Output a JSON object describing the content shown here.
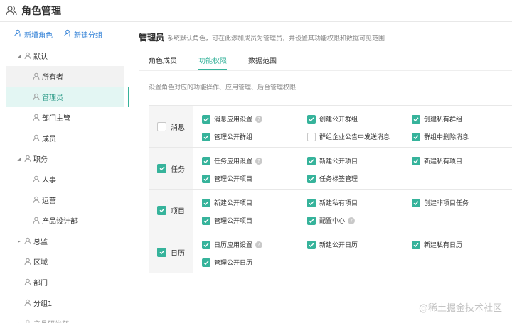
{
  "header": {
    "title": "角色管理",
    "icon": "users-icon"
  },
  "sidebar": {
    "actions": [
      {
        "label": "新增角色"
      },
      {
        "label": "新建分组"
      }
    ],
    "tree": [
      {
        "label": "默认",
        "level": 0,
        "caret": "expanded"
      },
      {
        "label": "所有者",
        "level": 1
      },
      {
        "label": "管理员",
        "level": 1,
        "selected": true
      },
      {
        "label": "部门主管",
        "level": 1
      },
      {
        "label": "成员",
        "level": 1
      },
      {
        "label": "职务",
        "level": 0,
        "caret": "expanded"
      },
      {
        "label": "人事",
        "level": 1
      },
      {
        "label": "运营",
        "level": 1
      },
      {
        "label": "产品设计部",
        "level": 1
      },
      {
        "label": "总监",
        "level": 0,
        "caret": "collapsed"
      },
      {
        "label": "区域",
        "level": 0
      },
      {
        "label": "部门",
        "level": 0
      },
      {
        "label": "分组1",
        "level": 0
      },
      {
        "label": "产品研发部",
        "level": 0,
        "caret": "collapsed"
      }
    ]
  },
  "main": {
    "role_name": "管理员",
    "role_desc": "系统默认角色，可在此添加成员为管理员，并设置其功能权限和数据可见范围",
    "tabs": [
      {
        "label": "角色成员"
      },
      {
        "label": "功能权限",
        "active": true
      },
      {
        "label": "数据范围"
      }
    ],
    "hint": "设置角色对应的功能操作、应用管理、后台管理权限",
    "permissions": [
      {
        "category": "消息",
        "checked": false,
        "items": [
          {
            "label": "消息应用设置",
            "checked": true,
            "help": true
          },
          {
            "label": "创建公开群组",
            "checked": true
          },
          {
            "label": "创建私有群组",
            "checked": true
          },
          {
            "label": "管理公开群组",
            "checked": true
          },
          {
            "label": "群组企业公告中发送消息",
            "checked": false
          },
          {
            "label": "群组中删除消息",
            "checked": true
          }
        ]
      },
      {
        "category": "任务",
        "checked": true,
        "items": [
          {
            "label": "任务应用设置",
            "checked": true,
            "help": true
          },
          {
            "label": "新建公开项目",
            "checked": true
          },
          {
            "label": "新建私有项目",
            "checked": true
          },
          {
            "label": "管理公开项目",
            "checked": true
          },
          {
            "label": "任务标签管理",
            "checked": true
          }
        ]
      },
      {
        "category": "项目",
        "checked": true,
        "items": [
          {
            "label": "新建公开项目",
            "checked": true
          },
          {
            "label": "新建私有项目",
            "checked": true
          },
          {
            "label": "创建非项目任务",
            "checked": true
          },
          {
            "label": "管理公开项目",
            "checked": true
          },
          {
            "label": "配置中心",
            "checked": true,
            "help": true
          }
        ]
      },
      {
        "category": "日历",
        "checked": true,
        "items": [
          {
            "label": "日历应用设置",
            "checked": true,
            "help": true
          },
          {
            "label": "新建公开日历",
            "checked": true
          },
          {
            "label": "新建私有日历",
            "checked": true
          },
          {
            "label": "管理公开日历",
            "checked": true
          }
        ]
      }
    ]
  },
  "watermark": "@稀土掘金技术社区",
  "colors": {
    "accent": "#36b39b",
    "link": "#2f7fd6",
    "selected_bg": "#e3f6f3"
  }
}
